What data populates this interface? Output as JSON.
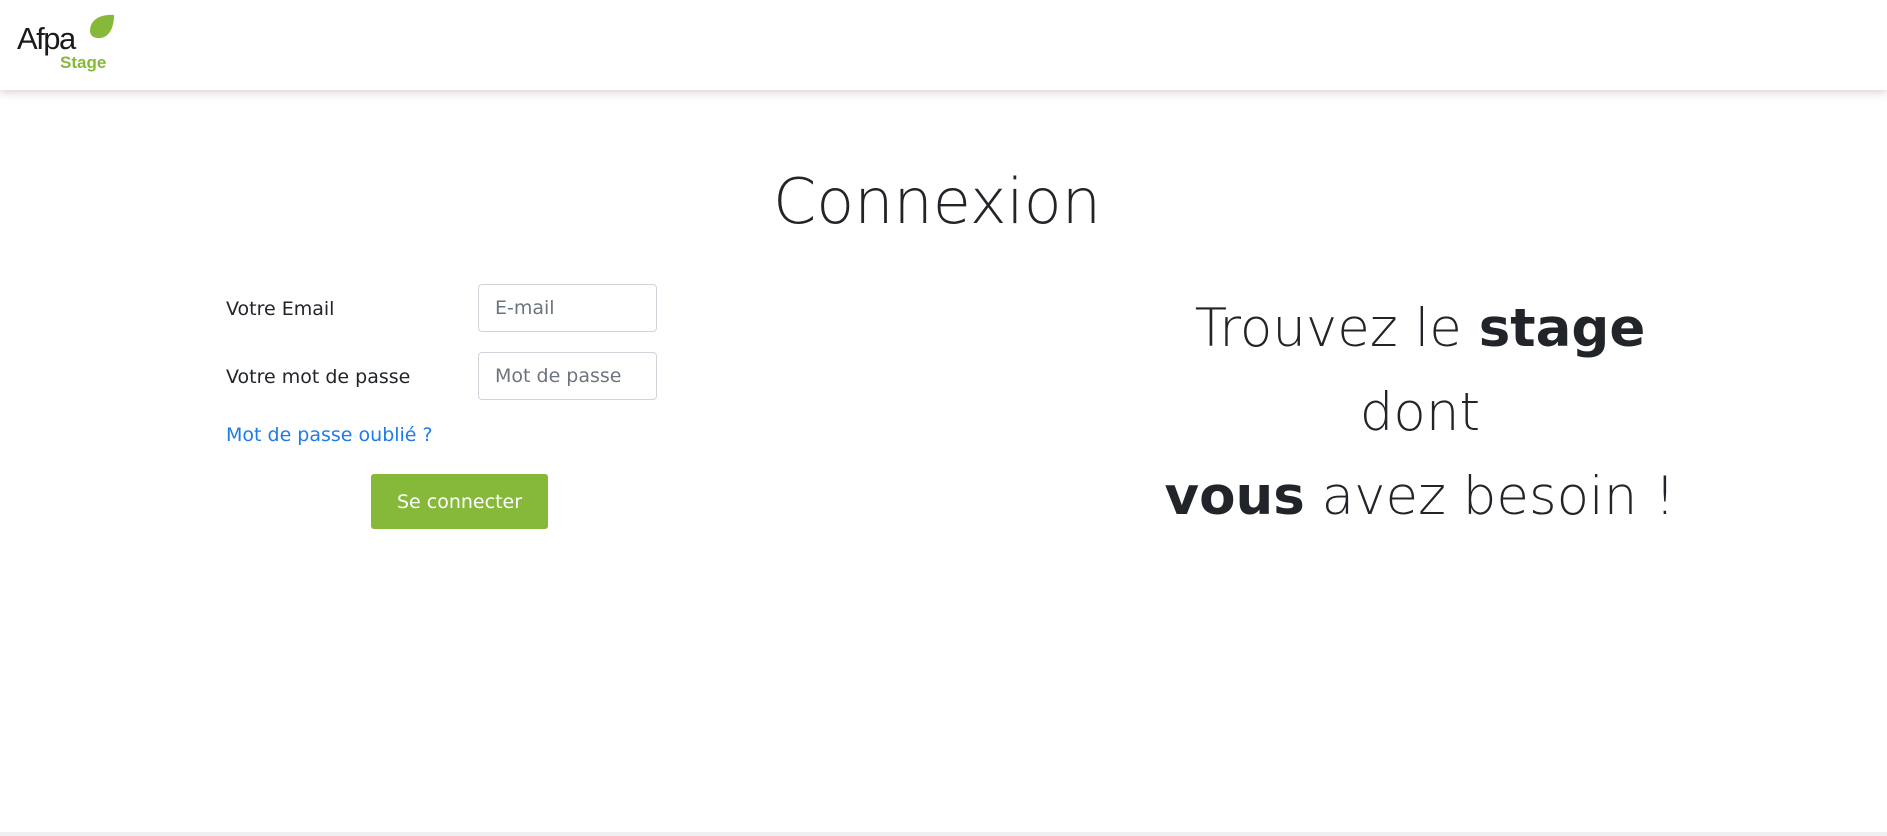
{
  "header": {
    "logo": {
      "brand": "Afpa",
      "sub": "Stage",
      "brand_color": "#86b83a",
      "icon": "leaf-icon"
    }
  },
  "main": {
    "title": "Connexion"
  },
  "login_form": {
    "email_label": "Votre Email",
    "email_placeholder": "E-mail",
    "email_value": "",
    "password_label": "Votre mot de passe",
    "password_placeholder": "Mot de passe",
    "password_value": "",
    "forgot_link": "Mot de passe oublié ?",
    "submit_label": "Se connecter",
    "accent_color": "#86b83a",
    "link_color": "#1f7be8"
  },
  "tagline": {
    "part1": "Trouvez le ",
    "bold1": "stage",
    "line2": "dont",
    "bold2": "vous",
    "part3": " avez besoin !"
  }
}
